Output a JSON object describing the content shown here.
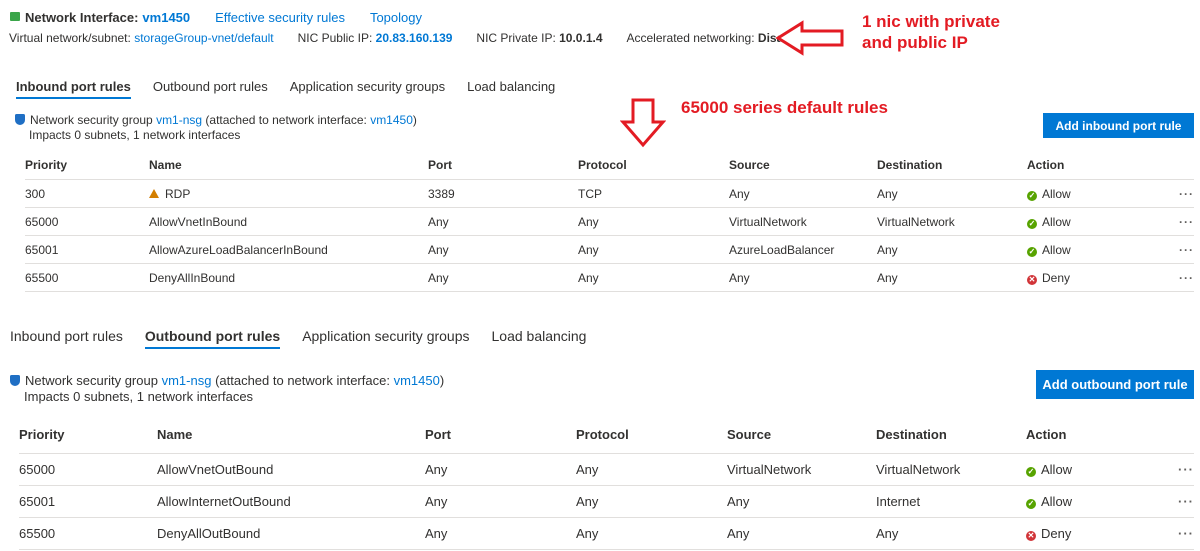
{
  "header": {
    "title_label": "Network Interface:",
    "nic_name": "vm1450",
    "effective_rules_link": "Effective security rules",
    "topology_link": "Topology",
    "vnet_label": "Virtual network/subnet:",
    "vnet_value": "storageGroup-vnet/default",
    "public_ip_label": "NIC Public IP:",
    "public_ip_value": "20.83.160.139",
    "private_ip_label": "NIC Private IP:",
    "private_ip_value": "10.0.1.4",
    "accel_label": "Accelerated networking:",
    "accel_value": "Disabled"
  },
  "annotations": {
    "nic_note_line1": "1 nic with private",
    "nic_note_line2": "and public IP",
    "default_rules_note": "65000 series default rules",
    "color": "#e31b23"
  },
  "tabs": [
    "Inbound port rules",
    "Outbound port rules",
    "Application security groups",
    "Load balancing"
  ],
  "nsg": {
    "prefix": "Network security group",
    "name": "vm1-nsg",
    "attached_text": "(attached to network interface:",
    "nic": "vm1450",
    "close": ")",
    "impacts": "Impacts 0 subnets, 1 network interfaces"
  },
  "columns": [
    "Priority",
    "Name",
    "Port",
    "Protocol",
    "Source",
    "Destination",
    "Action"
  ],
  "inbound": {
    "add_button": "Add inbound port rule",
    "rows": [
      {
        "priority": "300",
        "name": "RDP",
        "port": "3389",
        "protocol": "TCP",
        "source": "Any",
        "destination": "Any",
        "action": "Allow",
        "warning": true
      },
      {
        "priority": "65000",
        "name": "AllowVnetInBound",
        "port": "Any",
        "protocol": "Any",
        "source": "VirtualNetwork",
        "destination": "VirtualNetwork",
        "action": "Allow"
      },
      {
        "priority": "65001",
        "name": "AllowAzureLoadBalancerInBound",
        "port": "Any",
        "protocol": "Any",
        "source": "AzureLoadBalancer",
        "destination": "Any",
        "action": "Allow"
      },
      {
        "priority": "65500",
        "name": "DenyAllInBound",
        "port": "Any",
        "protocol": "Any",
        "source": "Any",
        "destination": "Any",
        "action": "Deny"
      }
    ]
  },
  "outbound": {
    "add_button": "Add outbound port rule",
    "rows": [
      {
        "priority": "65000",
        "name": "AllowVnetOutBound",
        "port": "Any",
        "protocol": "Any",
        "source": "VirtualNetwork",
        "destination": "VirtualNetwork",
        "action": "Allow"
      },
      {
        "priority": "65001",
        "name": "AllowInternetOutBound",
        "port": "Any",
        "protocol": "Any",
        "source": "Any",
        "destination": "Internet",
        "action": "Allow"
      },
      {
        "priority": "65500",
        "name": "DenyAllOutBound",
        "port": "Any",
        "protocol": "Any",
        "source": "Any",
        "destination": "Any",
        "action": "Deny"
      }
    ]
  },
  "more_label": "···",
  "colors": {
    "accent": "#0078d4",
    "allow": "#57a300",
    "deny": "#d13438",
    "warning": "#d37f00"
  }
}
